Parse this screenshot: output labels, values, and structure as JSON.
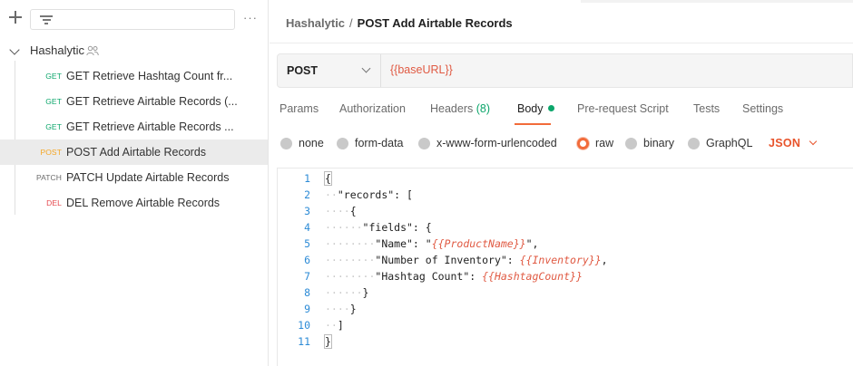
{
  "sidebar": {
    "collection_name": "Hashalytic",
    "requests": [
      {
        "method": "GET",
        "method_color": "#0ca66b",
        "name": "GET Retrieve Hashtag Count fr...",
        "active": false
      },
      {
        "method": "GET",
        "method_color": "#0ca66b",
        "name": "GET Retrieve Airtable Records (...",
        "active": false
      },
      {
        "method": "GET",
        "method_color": "#0ca66b",
        "name": "GET Retrieve Airtable Records ...",
        "active": false
      },
      {
        "method": "POST",
        "method_color": "#f5a623",
        "name": "POST Add Airtable Records",
        "active": true
      },
      {
        "method": "PATCH",
        "method_color": "#6b6b6b",
        "name": "PATCH Update Airtable Records",
        "active": false
      },
      {
        "method": "DEL",
        "method_color": "#e5484d",
        "name": "DEL Remove Airtable Records",
        "active": false
      }
    ]
  },
  "header": {
    "collection": "Hashalytic",
    "separator": "/",
    "title": "POST Add Airtable Records"
  },
  "request": {
    "method": "POST",
    "url": "{{baseURL}}"
  },
  "tabs": [
    {
      "label": "Params"
    },
    {
      "label": "Authorization"
    },
    {
      "label": "Headers",
      "count": "(8)"
    },
    {
      "label": "Body"
    },
    {
      "label": "Pre-request Script"
    },
    {
      "label": "Tests"
    },
    {
      "label": "Settings"
    }
  ],
  "body_types": [
    {
      "label": "none"
    },
    {
      "label": "form-data"
    },
    {
      "label": "x-www-form-urlencoded"
    },
    {
      "label": "raw"
    },
    {
      "label": "binary"
    },
    {
      "label": "GraphQL"
    }
  ],
  "body_format": "JSON",
  "editor": {
    "line_numbers": [
      "1",
      "2",
      "3",
      "4",
      "5",
      "6",
      "7",
      "8",
      "9",
      "10",
      "11"
    ],
    "lines": [
      [
        {
          "t": "{",
          "c": "s"
        }
      ],
      [
        {
          "t": "··",
          "c": "ws"
        },
        {
          "t": "\"records\": [",
          "c": "k"
        }
      ],
      [
        {
          "t": "····",
          "c": "ws"
        },
        {
          "t": "{",
          "c": "s"
        }
      ],
      [
        {
          "t": "······",
          "c": "ws"
        },
        {
          "t": "\"fields\": {",
          "c": "k"
        }
      ],
      [
        {
          "t": "········",
          "c": "ws"
        },
        {
          "t": "\"Name\": \"",
          "c": "k"
        },
        {
          "t": "{{ProductName}}",
          "c": "v"
        },
        {
          "t": "\",",
          "c": "k"
        }
      ],
      [
        {
          "t": "········",
          "c": "ws"
        },
        {
          "t": "\"Number of Inventory\": ",
          "c": "k"
        },
        {
          "t": "{{Inventory}}",
          "c": "v"
        },
        {
          "t": ",",
          "c": "k"
        }
      ],
      [
        {
          "t": "········",
          "c": "ws"
        },
        {
          "t": "\"Hashtag Count\": ",
          "c": "k"
        },
        {
          "t": "{{HashtagCount}}",
          "c": "v"
        }
      ],
      [
        {
          "t": "······",
          "c": "ws"
        },
        {
          "t": "}",
          "c": "s"
        }
      ],
      [
        {
          "t": "····",
          "c": "ws"
        },
        {
          "t": "}",
          "c": "s"
        }
      ],
      [
        {
          "t": "··",
          "c": "ws"
        },
        {
          "t": "]",
          "c": "s"
        }
      ],
      [
        {
          "t": "}",
          "c": "s"
        }
      ]
    ]
  }
}
